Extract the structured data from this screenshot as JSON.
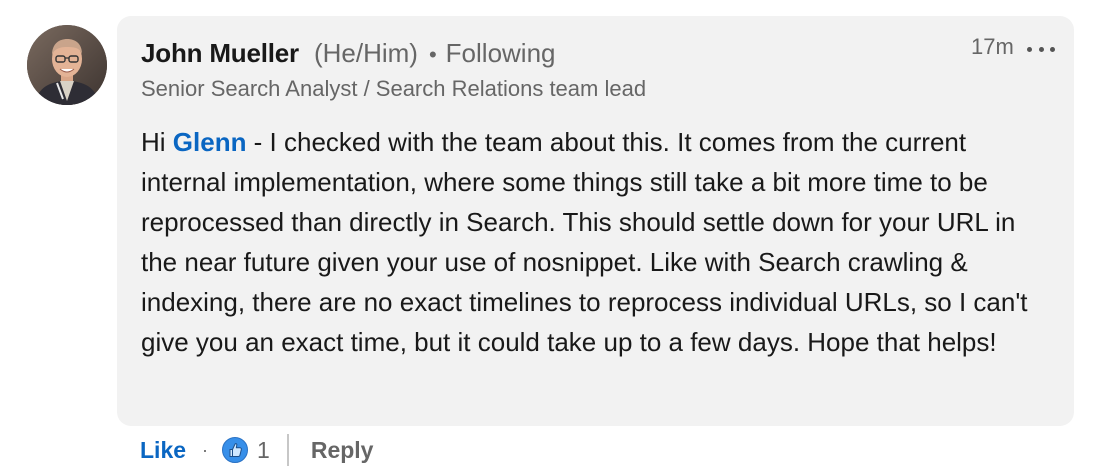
{
  "comment": {
    "author": {
      "name": "John Mueller",
      "pronouns": "(He/Him)",
      "separator": "•",
      "relationship": "Following",
      "headline": "Senior Search Analyst / Search Relations team lead",
      "avatar_icon": "profile-photo"
    },
    "timestamp": "17m",
    "more_icon": "ellipsis-icon",
    "text": {
      "greeting": "Hi ",
      "mention": "Glenn",
      "body": " - I checked with the team about this. It comes from the current internal implementation, where some things still take a bit more time to be reprocessed than directly in Search. This should settle down for your URL in the near future given your use of nosnippet. Like with Search crawling & indexing, there are no exact timelines to reprocess individual URLs, so I can't give you an exact time, but it could take up to a few days. Hope that helps!"
    },
    "actions": {
      "like_label": "Like",
      "dot": "·",
      "reaction_icon": "thumbs-up-icon",
      "reaction_count": "1",
      "reply_label": "Reply"
    }
  },
  "colors": {
    "link_blue": "#0a66c2",
    "bubble_bg": "#f2f2f2",
    "muted_text": "#666666",
    "primary_text": "#191919"
  }
}
